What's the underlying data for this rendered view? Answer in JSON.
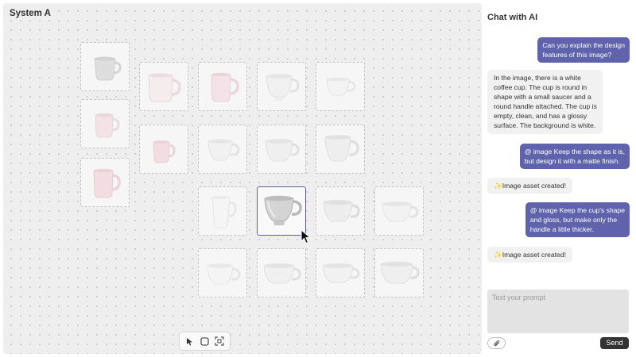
{
  "canvas": {
    "title": "System A",
    "images": [
      {
        "kind": "cup",
        "tint": "#e3e3e3"
      },
      {
        "kind": "cup",
        "tint": "#f1dfe3"
      },
      {
        "kind": "cup",
        "tint": "#f3dde2"
      },
      {
        "kind": "cup",
        "tint": "#f3e1e5"
      },
      {
        "kind": "cup",
        "tint": "#efdce1"
      },
      {
        "kind": "cup",
        "tint": "#f2d9e0"
      },
      {
        "kind": "cup",
        "tint": "#f0f0f0"
      },
      {
        "kind": "cup",
        "tint": "#ededed"
      },
      {
        "kind": "cup",
        "tint": "#f3f3f3"
      },
      {
        "kind": "cup",
        "tint": "#eeeeee"
      },
      {
        "kind": "cup",
        "tint": "#ebebeb"
      },
      {
        "kind": "cup",
        "tint": "#f2f2f2"
      },
      {
        "kind": "cup",
        "tint": "#cfcfcf",
        "selected": true
      },
      {
        "kind": "cup",
        "tint": "#ededed"
      },
      {
        "kind": "cup",
        "tint": "#efefef"
      },
      {
        "kind": "cup",
        "tint": "#f2f2f2"
      },
      {
        "kind": "cup",
        "tint": "#ececec"
      },
      {
        "kind": "cup",
        "tint": "#efefef"
      },
      {
        "kind": "cup",
        "tint": "#ededed"
      }
    ],
    "toolbar": {
      "tools": [
        "pointer-icon",
        "frame-icon",
        "scan-icon"
      ]
    }
  },
  "chat": {
    "title": "Chat with AI",
    "messages": [
      {
        "role": "user",
        "lines": [
          "Can you explain the design",
          "features of this image?"
        ]
      },
      {
        "role": "ai",
        "lines": [
          "In the image, there is a white",
          "coffee cup. The cup is round in",
          "shape with a small saucer and a",
          "round handle attached. The cup is",
          "empty, clean, and has a glossy",
          "surface. The background is white."
        ]
      },
      {
        "role": "user",
        "lines": [
          "@ image Keep the shape as it is,",
          "but design it with a matte finish."
        ]
      },
      {
        "role": "status",
        "text": "✨Image asset created!"
      },
      {
        "role": "user",
        "lines": [
          "@ image Keep the cup's shape",
          "and gloss, but make only the",
          "handle a little thicker."
        ]
      },
      {
        "role": "status",
        "text": "✨Image asset created!"
      }
    ],
    "prompt_placeholder": "Text your prompt",
    "send_label": "Send",
    "attach_icon": "paperclip-icon"
  }
}
